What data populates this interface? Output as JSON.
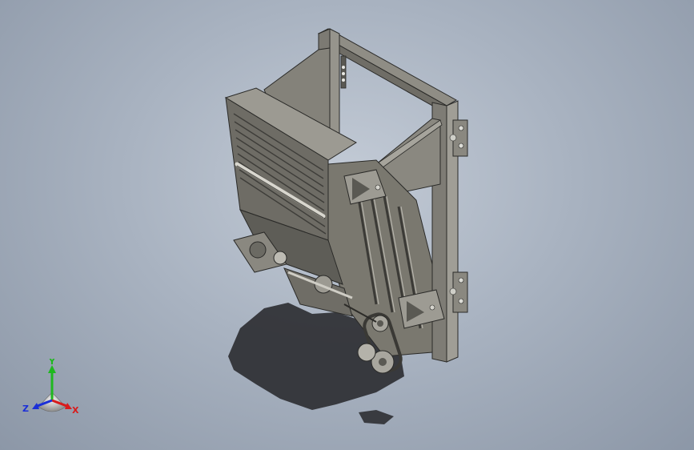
{
  "triad": {
    "x_label": "X",
    "y_label": "Y",
    "z_label": "Z",
    "x_color": "#d81b1b",
    "y_color": "#1fb81f",
    "z_color": "#1b2fd8"
  },
  "colors": {
    "background_center": "#c3cbd6",
    "background_edge": "#8c97a7",
    "model_body": "#8d8b83",
    "model_dark": "#4e4d48",
    "shadow": "#2f3033"
  }
}
